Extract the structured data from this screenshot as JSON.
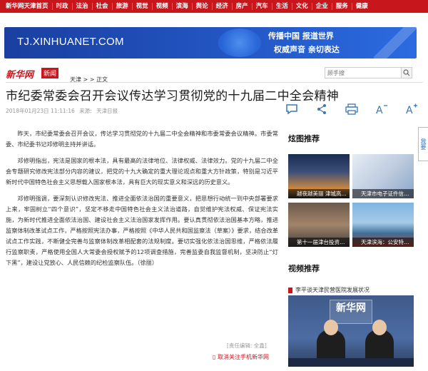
{
  "nav": [
    "新华网天津首页",
    "时政",
    "法治",
    "社会",
    "旅游",
    "视觉",
    "视频",
    "滨海",
    "舆论",
    "经济",
    "房产",
    "汽车",
    "生活",
    "文化",
    "企业",
    "服务",
    "健康"
  ],
  "banner": {
    "site": "TJ.XINHUANET.COM",
    "slogan_line1": "传播中国  报道世界",
    "slogan_line2": "权威声音  亲切表达"
  },
  "logo": {
    "name": "新华网",
    "badge": "新闻"
  },
  "breadcrumb": "天津 >  >  正文",
  "search": {
    "placeholder": "顾手搜"
  },
  "article": {
    "title": "市纪委常委会召开会议传达学习贯彻党的十九届二中全会精神",
    "datetime": "2018年01月23日 11:11:16",
    "source_label": "来源:",
    "source": "天津日报",
    "paragraphs": [
      "昨天，市纪委常委会召开会议，传达学习贯彻党的十九届二中全会精神和市委常委会议精神。市委常委、市纪委书记邓修明主持并讲话。",
      "邓修明指出，宪法是国家的根本法，具有最高的法律地位、法律权威、法律效力。党的十九届二中全会专题研究修改宪法部分内容的建议，把党的十九大确定的重大理论观点和重大方针政策，特别是习近平新时代中国特色社会主义思想载入国家根本法，具有巨大的现实意义和深远的历史意义。",
      "邓修明强调，要深刻认识修改宪法、推进全面依法治国的重要意义，把思想行动统一到中央部署要求上来，牢固树立“四个意识”，坚定不移走中国特色社会主义法治道路，自觉维护宪法权威、保证宪法实施，为新时代推进全面依法治国、建设社会主义法治国家发挥作用。要认真贯彻依法治国基本方略，推进监察体制改革试点工作，严格按照宪法办事，严格按照《中华人民共和国监察法（草案）》要求，结合改革试点工作实践，不断健全完善与监察体制改革相配套的法规制度。要切实强化依法治国思维，严格依法履行监察职责，严格使用全国人大常委会授权赋予的12项调查措施，完善监委自我监督机制，坚决防止“灯下黑”，建设让党放心、人民信赖的纪检监察队伍。（徐丽）"
    ],
    "editor": "[责任编辑: 全鑫]",
    "follow": "取消关注手机新华网"
  },
  "tools": [
    {
      "icon": "comment-icon",
      "glyph": "◯"
    },
    {
      "icon": "share-icon",
      "glyph": "<"
    },
    {
      "icon": "print-icon",
      "glyph": "▭"
    },
    {
      "icon": "font-decrease-icon",
      "glyph": "A"
    },
    {
      "icon": "font-increase-icon",
      "glyph": "A"
    }
  ],
  "sidebar": {
    "photo_title": "炫图推荐",
    "photos": [
      {
        "caption": "越夜越美丽 津城高…"
      },
      {
        "caption": "天津市电子证件信…"
      },
      {
        "caption": "第十一届津台投资…"
      },
      {
        "caption": "天津滨海：公安特…"
      }
    ],
    "video_title": "视频推荐",
    "video_caption": "李平谈天津民营医院发展状况",
    "video_logo": "新华网"
  },
  "rail_label": "我要"
}
